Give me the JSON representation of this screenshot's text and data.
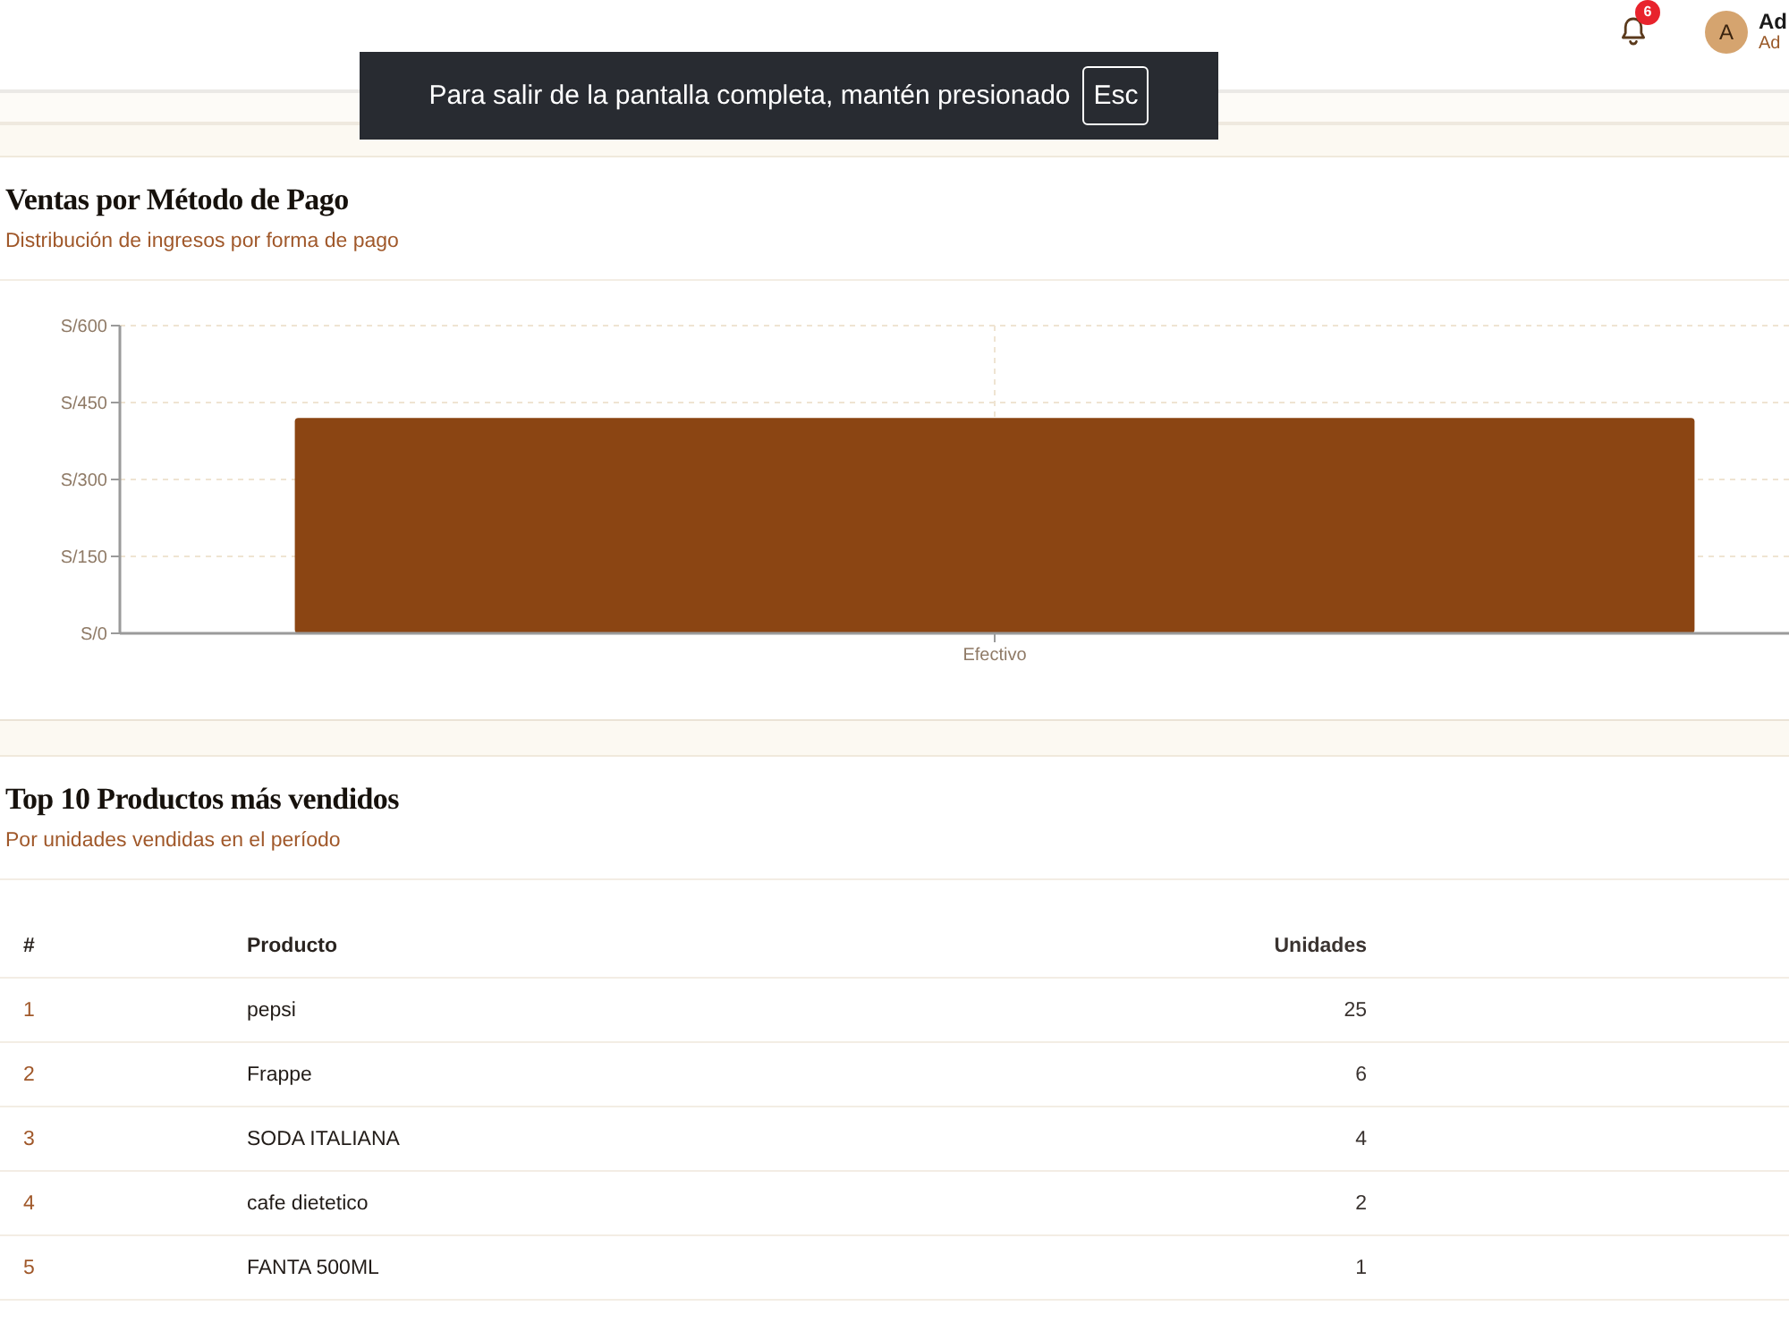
{
  "header": {
    "notifications": {
      "count": "6"
    },
    "user": {
      "avatar_initial": "A",
      "name": "Ad",
      "role": "Ad"
    }
  },
  "fullscreen_notice": {
    "message": "Para salir de la pantalla completa, mantén presionado",
    "key": "Esc"
  },
  "payment_chart_card": {
    "title": "Ventas por Método de Pago",
    "subtitle": "Distribución de ingresos por forma de pago",
    "chart_data": {
      "type": "bar",
      "grid": true,
      "categories": [
        "Efectivo"
      ],
      "values": [
        420
      ],
      "ylim": [
        0,
        600
      ],
      "yticks": [
        {
          "value": 0,
          "label": "S/0"
        },
        {
          "value": 150,
          "label": "S/150"
        },
        {
          "value": 300,
          "label": "S/300"
        },
        {
          "value": 450,
          "label": "S/450"
        },
        {
          "value": 600,
          "label": "S/600"
        }
      ]
    }
  },
  "top_products_card": {
    "title": "Top 10 Productos más vendidos",
    "subtitle": "Por unidades vendidas en el período",
    "table": {
      "columns": [
        "#",
        "Producto",
        "Unidades"
      ],
      "rows": [
        [
          "1",
          "pepsi",
          "25"
        ],
        [
          "2",
          "Frappe",
          "6"
        ],
        [
          "3",
          "SODA ITALIANA",
          "4"
        ],
        [
          "4",
          "cafe dietetico",
          "2"
        ],
        [
          "5",
          "FANTA 500ML",
          "1"
        ]
      ]
    }
  }
}
